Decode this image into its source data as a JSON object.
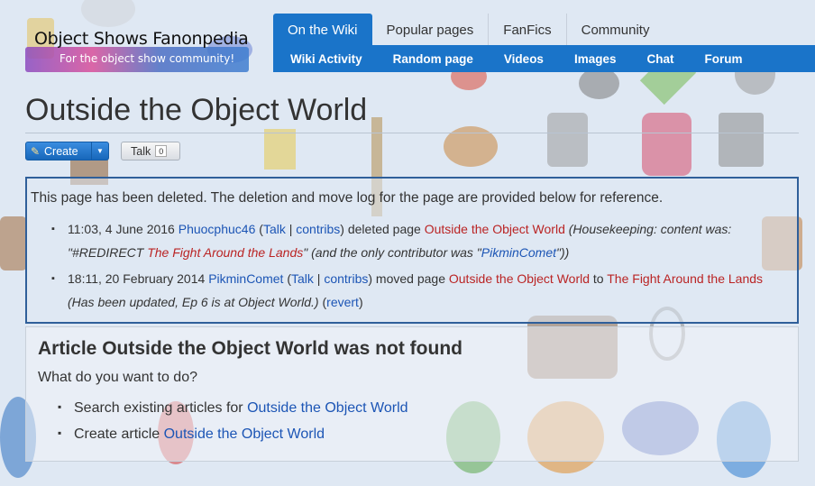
{
  "site": {
    "name": "Object Shows Fanonpedia",
    "tagline": "For the object show community!"
  },
  "nav": {
    "tabs": [
      "On the Wiki",
      "Popular pages",
      "FanFics",
      "Community"
    ],
    "active_tab": "On the Wiki",
    "sub": [
      "Wiki Activity",
      "Random page",
      "Videos",
      "Images",
      "Chat",
      "Forum"
    ]
  },
  "page": {
    "title": "Outside the Object World",
    "create_label": "Create",
    "talk_label": "Talk",
    "talk_count": "0"
  },
  "deletion": {
    "intro": "This page has been deleted. The deletion and move log for the page are provided below for reference.",
    "entries": [
      {
        "time": "11:03, 4 June 2016",
        "user": "Phuocphuc46",
        "talk": "Talk",
        "contribs": "contribs",
        "action": "deleted page",
        "page": "Outside the Object World",
        "reason_prefix": "(Housekeeping: content was:",
        "reason_quote_open": "\"#REDIRECT ",
        "reason_link": "The Fight Around the Lands",
        "reason_mid": "\" (and the only contributor was \"",
        "reason_user": "PikminComet",
        "reason_end": "\"))"
      },
      {
        "time": "18:11, 20 February 2014",
        "user": "PikminComet",
        "talk": "Talk",
        "contribs": "contribs",
        "action": "moved page",
        "page": "Outside the Object World",
        "to": "to",
        "target": "The Fight Around the Lands",
        "reason": "(Has been updated, Ep 6 is at Object World.)",
        "revert": "revert"
      }
    ]
  },
  "notfound": {
    "heading": "Article Outside the Object World was not found",
    "question": "What do you want to do?",
    "options": [
      {
        "prefix": "Search existing articles for ",
        "link": "Outside the Object World"
      },
      {
        "prefix": "Create article ",
        "link": "Outside the Object World"
      }
    ]
  },
  "colors": {
    "nav_blue": "#1a74c9",
    "link_blue": "#1c55b5",
    "redlink": "#ba2424",
    "box_border": "#2f5f9a"
  }
}
